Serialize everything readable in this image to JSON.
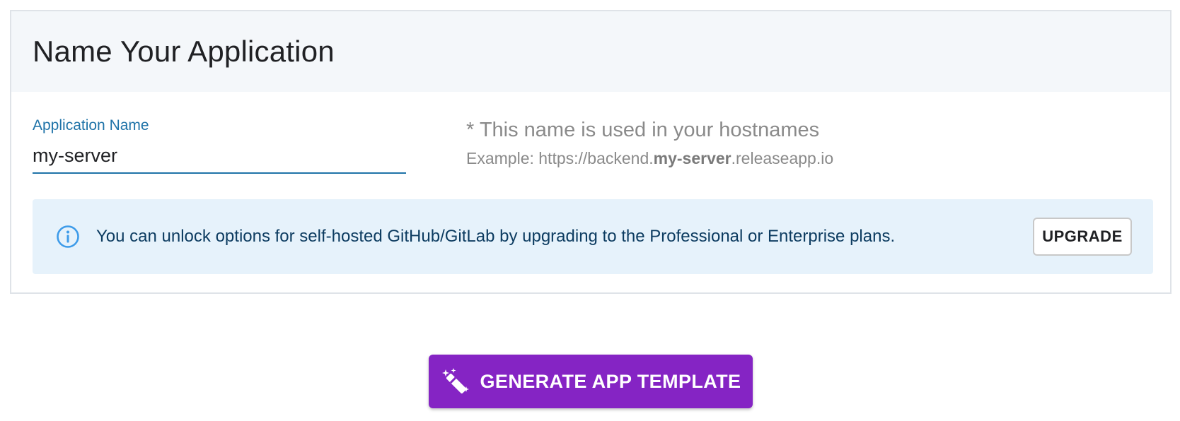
{
  "card": {
    "title": "Name Your Application"
  },
  "field": {
    "label": "Application Name",
    "value": "my-server"
  },
  "hint": {
    "main": "* This name is used in your hostnames",
    "example_prefix": "Example: https://backend.",
    "example_bold": "my-server",
    "example_suffix": ".releaseapp.io"
  },
  "alert": {
    "icon": "info-icon",
    "text": "You can unlock options for self-hosted GitHub/GitLab by upgrading to the Professional or Enterprise plans.",
    "button_label": "UPGRADE",
    "color": "#e6f2fb",
    "icon_color": "#3d9be9"
  },
  "generate": {
    "icon": "magic-wand-icon",
    "label": "GENERATE APP TEMPLATE",
    "color": "#8524c4"
  },
  "colors": {
    "accent": "#1f73a8",
    "header_bg": "#f4f7fa"
  }
}
